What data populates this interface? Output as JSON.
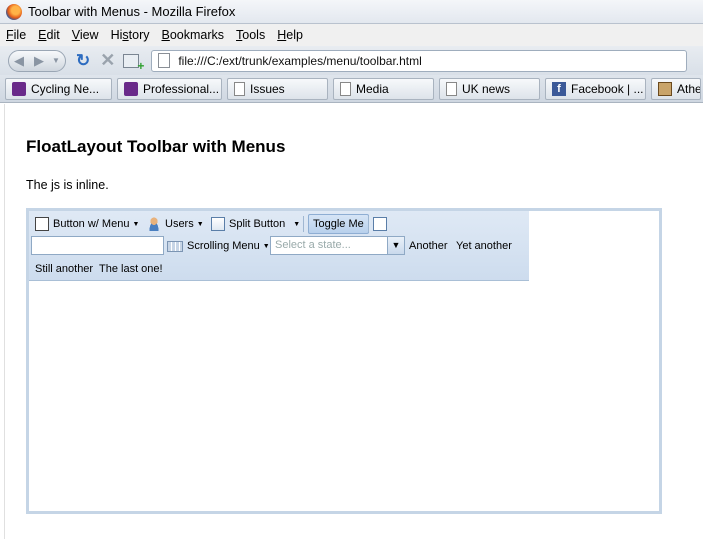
{
  "window": {
    "title": "Toolbar with Menus - Mozilla Firefox"
  },
  "menubar": [
    {
      "underline": "F",
      "rest": "ile"
    },
    {
      "underline": "E",
      "rest": "dit"
    },
    {
      "underline": "V",
      "rest": "iew"
    },
    {
      "pre": "Hi",
      "underline": "s",
      "rest": "tory"
    },
    {
      "underline": "B",
      "rest": "ookmarks"
    },
    {
      "underline": "T",
      "rest": "ools"
    },
    {
      "underline": "H",
      "rest": "elp"
    }
  ],
  "nav": {
    "url": "file:///C:/ext/trunk/examples/menu/toolbar.html"
  },
  "bookmarks": [
    {
      "label": "Cycling Ne...",
      "icon": "cycling-icon"
    },
    {
      "label": "Professional...",
      "icon": "cycling-icon"
    },
    {
      "label": "Issues",
      "icon": "page-icon"
    },
    {
      "label": "Media",
      "icon": "page-icon"
    },
    {
      "label": "UK news",
      "icon": "page-icon"
    },
    {
      "label": "Facebook | ...",
      "icon": "facebook-icon"
    },
    {
      "label": "Athe",
      "icon": "athena-icon"
    }
  ],
  "page": {
    "heading": "FloatLayout Toolbar with Menus",
    "paragraph": "The js is inline."
  },
  "toolbar": {
    "button_menu": "Button w/ Menu",
    "users": "Users",
    "split_button": "Split Button",
    "toggle": "Toggle Me",
    "scrolling_menu": "Scrolling Menu",
    "state_placeholder": "Select a state...",
    "another": "Another",
    "yet_another": "Yet another",
    "still_another": "Still another",
    "last_one": "The last one!",
    "text_value": ""
  }
}
